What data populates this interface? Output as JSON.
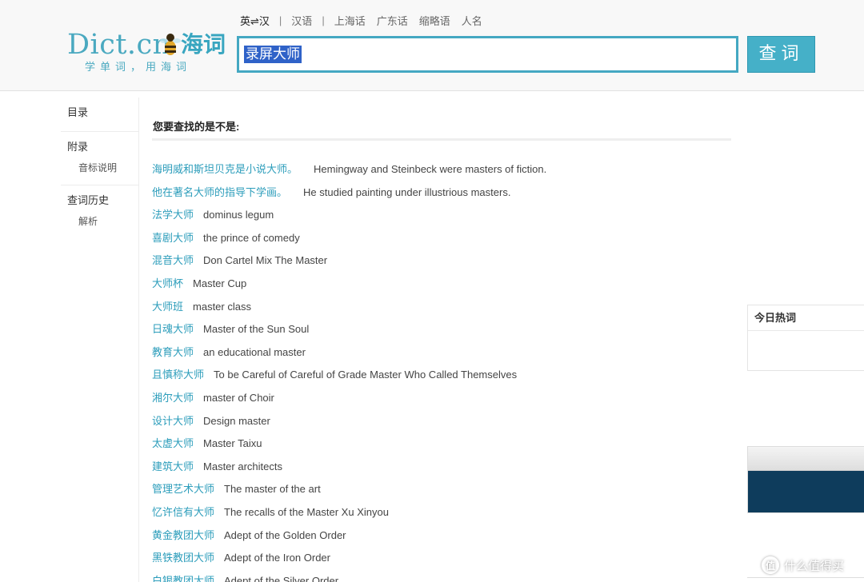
{
  "header": {
    "logo": {
      "main_text": "Dict.cn",
      "cn_text": "海词",
      "slogan": "学单词，用海词"
    },
    "lang_tabs": [
      {
        "label": "英⇌汉",
        "active": true
      },
      {
        "label": "汉语",
        "active": false
      },
      {
        "label": "上海话",
        "active": false
      },
      {
        "label": "广东话",
        "active": false
      },
      {
        "label": "缩略语",
        "active": false
      },
      {
        "label": "人名",
        "active": false
      }
    ],
    "search": {
      "value": "录屏大师",
      "button_label": "查词"
    }
  },
  "sidebar": {
    "groups": [
      {
        "label": "目录",
        "items": []
      },
      {
        "label": "附录",
        "items": [
          {
            "label": "音标说明"
          }
        ]
      },
      {
        "label": "查词历史",
        "items": [
          {
            "label": "解析"
          }
        ]
      }
    ]
  },
  "main": {
    "title": "您要查找的是不是:",
    "results": [
      {
        "cn": "海明威和斯坦贝克是小说大师。",
        "en": "Hemingway and Steinbeck were masters of fiction."
      },
      {
        "cn": "他在著名大师的指导下学画。",
        "en": "He studied painting under illustrious masters."
      },
      {
        "cn": "法学大师",
        "en": "dominus legum"
      },
      {
        "cn": "喜剧大师",
        "en": "the prince of comedy"
      },
      {
        "cn": "混音大师",
        "en": "Don Cartel Mix The Master"
      },
      {
        "cn": "大师杯",
        "en": "Master Cup"
      },
      {
        "cn": "大师班",
        "en": "master class"
      },
      {
        "cn": "日魂大师",
        "en": "Master of the Sun Soul"
      },
      {
        "cn": "教育大师",
        "en": "an educational master"
      },
      {
        "cn": "且慎称大师",
        "en": "To be Careful of Careful of Grade Master Who Called Themselves"
      },
      {
        "cn": "湘尔大师",
        "en": "master of Choir"
      },
      {
        "cn": "设计大师",
        "en": "Design master"
      },
      {
        "cn": "太虚大师",
        "en": "Master Taixu"
      },
      {
        "cn": "建筑大师",
        "en": "Master architects"
      },
      {
        "cn": "管理艺术大师",
        "en": "The master of the art"
      },
      {
        "cn": "忆许信有大师",
        "en": "The recalls of the Master Xu Xinyou"
      },
      {
        "cn": "黄金教团大师",
        "en": "Adept of the Golden Order"
      },
      {
        "cn": "黑铁教团大师",
        "en": "Adept of the Iron Order"
      },
      {
        "cn": "白银教团大师",
        "en": "Adept of the Silver Order"
      }
    ]
  },
  "right": {
    "hot_title": "今日热词"
  },
  "watermark": {
    "icon": "值",
    "text": "什么值得买"
  },
  "colors": {
    "accent": "#44a8c2",
    "link": "#2c9dbb",
    "dark_panel": "#0e3c5c",
    "selection": "#2f62c8"
  }
}
